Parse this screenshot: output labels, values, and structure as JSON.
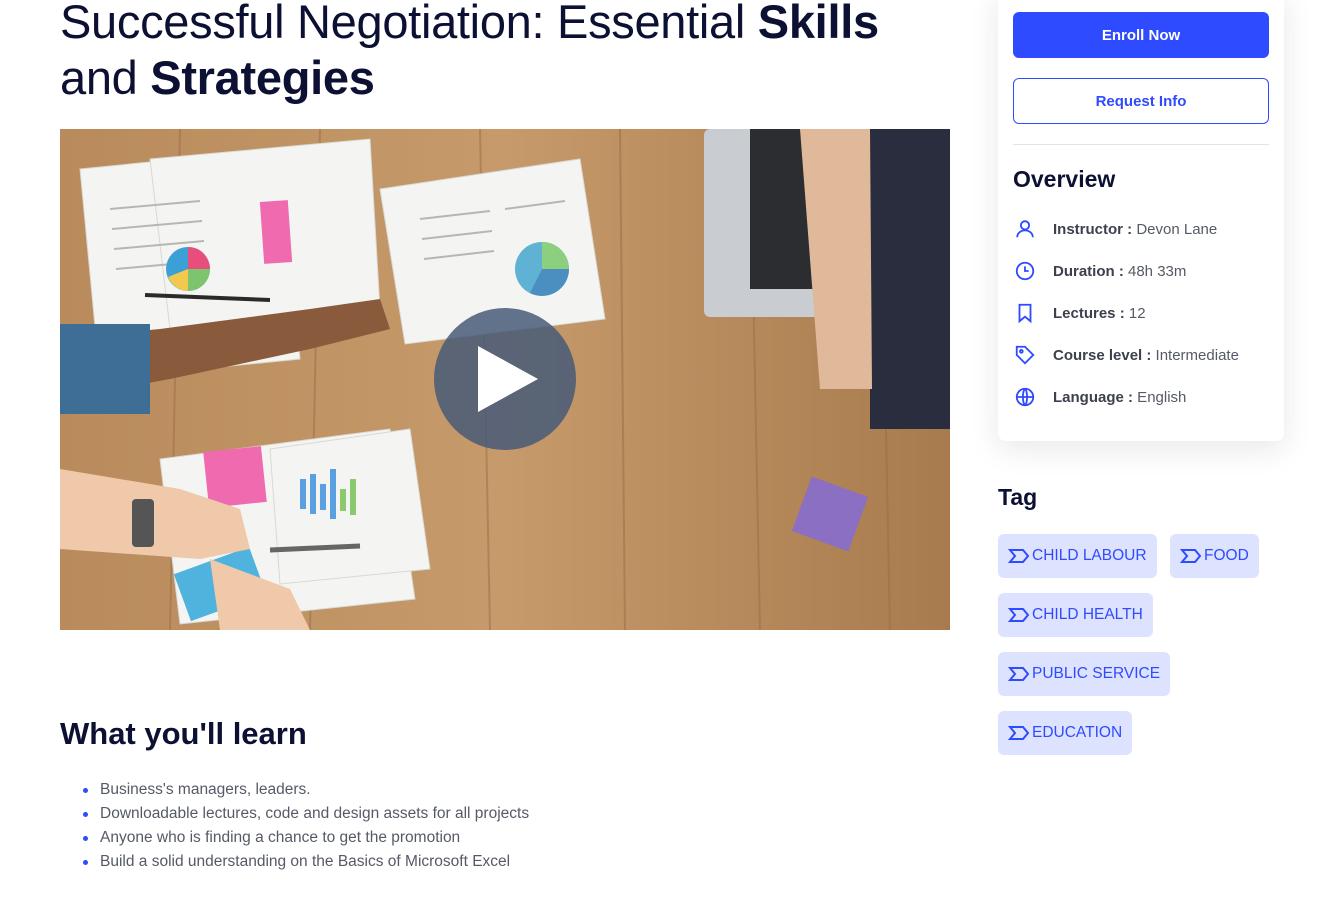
{
  "course": {
    "title_part1": "Successful Negotiation: Essential ",
    "title_bold1": "Skills",
    "title_part2": "and ",
    "title_bold2": "Strategies"
  },
  "video": {
    "play_icon": "play-icon"
  },
  "learn": {
    "title": "What you'll learn",
    "items": [
      "Business's managers, leaders.",
      "Downloadable lectures, code and design assets for all projects",
      "Anyone who is finding a chance to get the promotion",
      "Build a solid understanding on the Basics of Microsoft Excel"
    ]
  },
  "sidebar": {
    "enroll_label": "Enroll Now",
    "request_label": "Request Info",
    "overview_title": "Overview",
    "overview": [
      {
        "icon": "user-icon",
        "label": "Instructor :",
        "value": " Devon Lane"
      },
      {
        "icon": "clock-icon",
        "label": "Duration :",
        "value": " 48h 33m"
      },
      {
        "icon": "bookmark-icon",
        "label": "Lectures :",
        "value": " 12"
      },
      {
        "icon": "tag-icon",
        "label": "Course level :",
        "value": " Intermediate"
      },
      {
        "icon": "globe-icon",
        "label": "Language :",
        "value": " English"
      }
    ],
    "accent": "#2f4bff"
  },
  "tags": {
    "title": "Tag",
    "items": [
      "CHILD LABOUR",
      "FOOD",
      "CHILD HEALTH",
      "PUBLIC SERVICE",
      "EDUCATION"
    ]
  }
}
